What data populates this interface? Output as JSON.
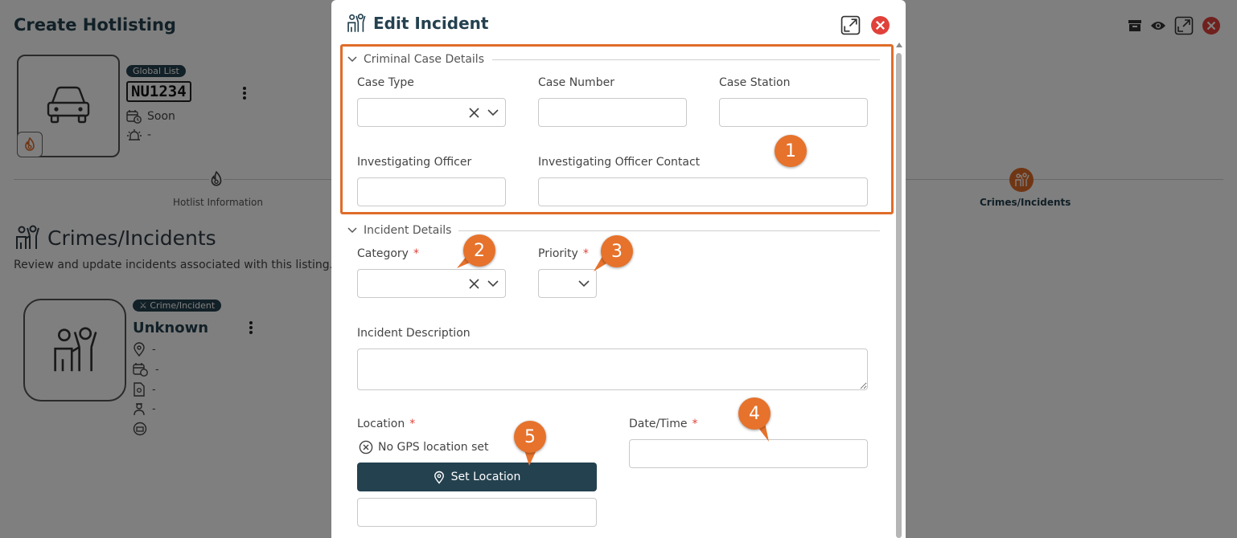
{
  "background": {
    "title": "Create Hotlisting",
    "vehicle": {
      "list_badge": "Global List",
      "plate": "NU1234",
      "expiry": "Soon",
      "alert": "-"
    },
    "tabs": [
      {
        "label": "Hotlist Information",
        "active": false
      },
      {
        "label": "Crimes/Incidents",
        "active": true
      }
    ],
    "section_title": "Crimes/Incidents",
    "section_subtitle": "Review and update incidents associated with this listing.",
    "incident": {
      "badge": "Crime/Incident",
      "name": "Unknown",
      "location": "-",
      "date": "-",
      "document": "-",
      "officer": "-"
    }
  },
  "modal": {
    "title": "Edit Incident",
    "criminal_section": {
      "title": "Criminal Case Details",
      "case_type_label": "Case Type",
      "case_number_label": "Case Number",
      "case_station_label": "Case Station",
      "investigating_officer_label": "Investigating Officer",
      "investigating_officer_contact_label": "Investigating Officer Contact"
    },
    "incident_section": {
      "title": "Incident Details",
      "category_label": "Category",
      "priority_label": "Priority",
      "description_label": "Incident Description",
      "location_label": "Location",
      "datetime_label": "Date/Time",
      "required_mark": "*",
      "gps_status": "No GPS location set",
      "set_location_label": "Set Location"
    }
  },
  "annotations": {
    "callouts": [
      "1",
      "2",
      "3",
      "4",
      "5"
    ],
    "accent_color": "#e6722c"
  },
  "colors": {
    "primary": "#24414f",
    "required": "#e0413a",
    "close": "#e0413a"
  }
}
